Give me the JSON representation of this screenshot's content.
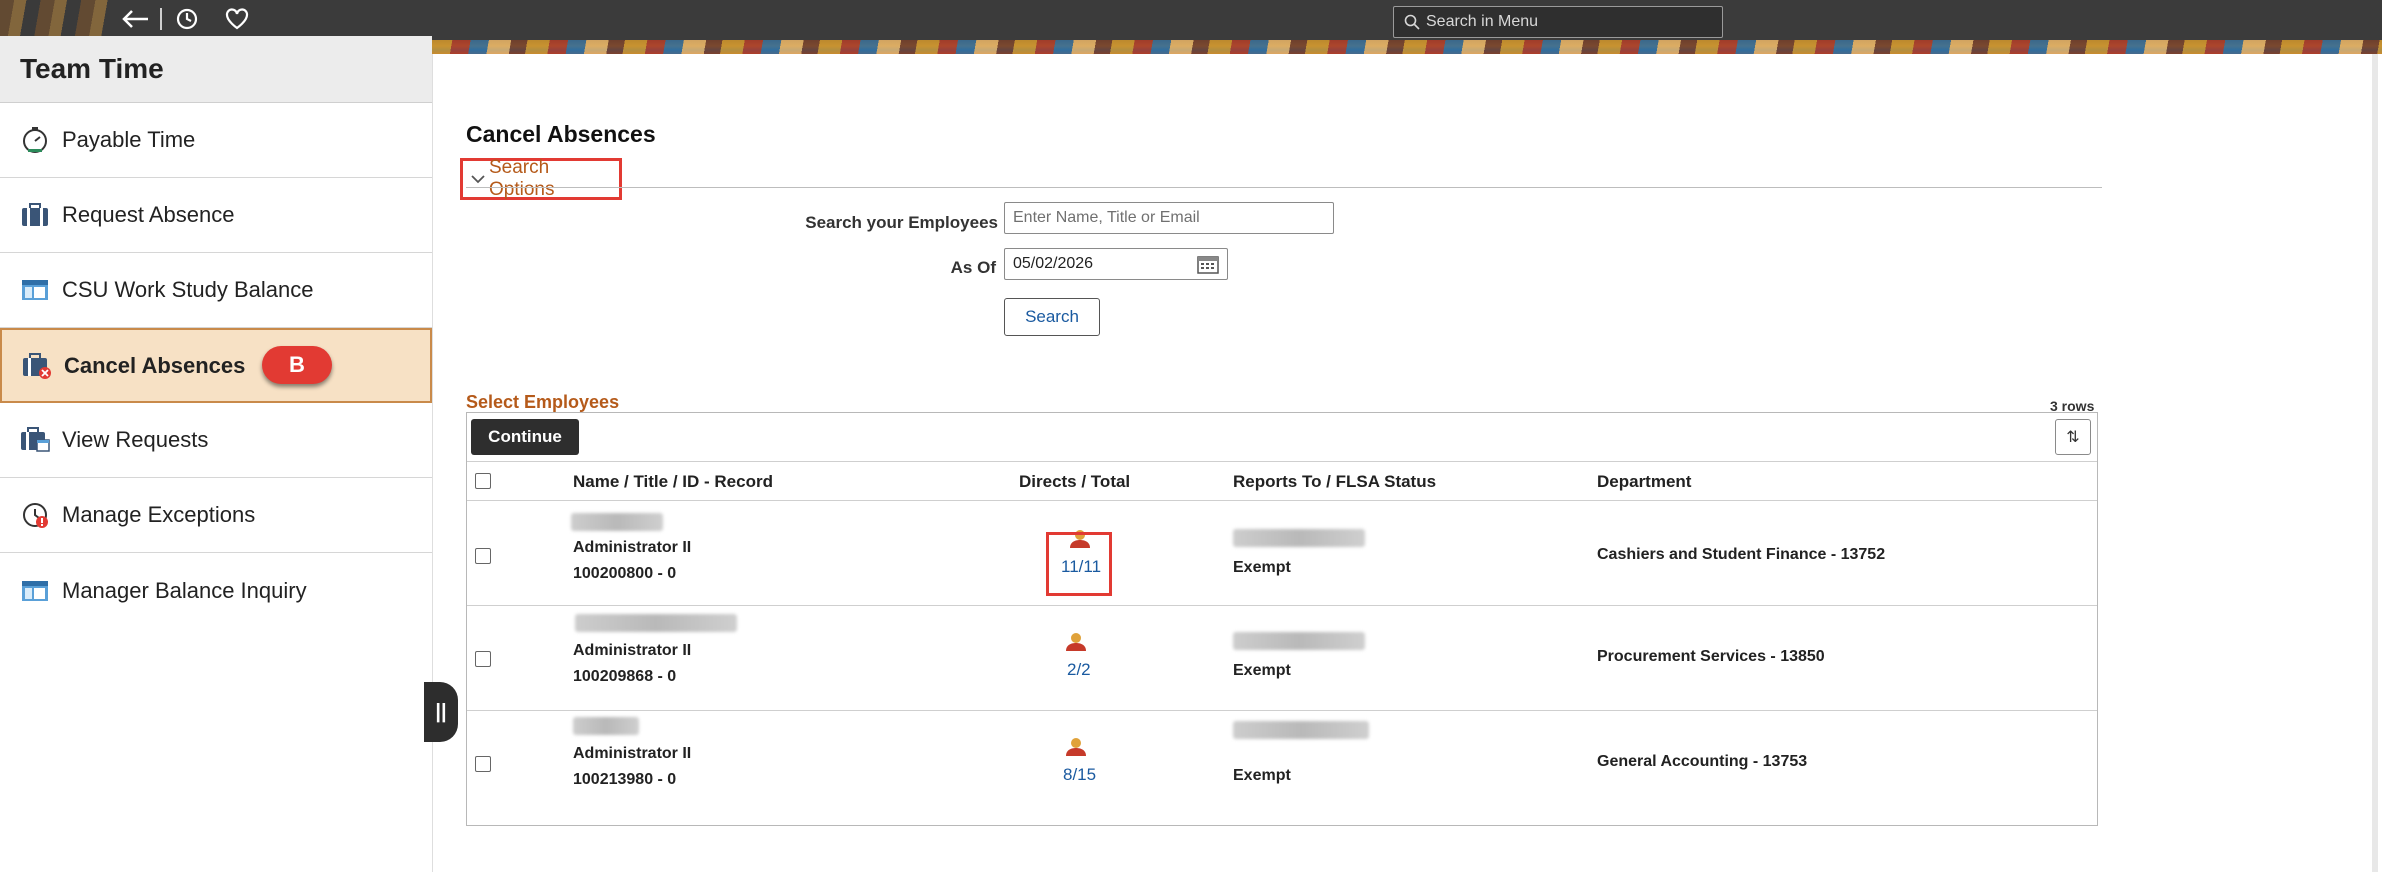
{
  "header": {
    "search_placeholder": "Search in Menu",
    "icons": [
      "back-arrow-icon",
      "history-icon",
      "favorites-icon",
      "search-icon"
    ]
  },
  "sidebar": {
    "title": "Team Time",
    "items": [
      {
        "label": "Payable Time",
        "icon": "stopwatch-icon"
      },
      {
        "label": "Request Absence",
        "icon": "briefcase-icon"
      },
      {
        "label": "CSU Work Study Balance",
        "icon": "table-icon"
      },
      {
        "label": "Cancel Absences",
        "icon": "briefcase-cancel-icon",
        "active": true,
        "badge": "B"
      },
      {
        "label": "View Requests",
        "icon": "briefcase-calendar-icon"
      },
      {
        "label": "Manage Exceptions",
        "icon": "exception-clock-icon"
      },
      {
        "label": "Manager Balance Inquiry",
        "icon": "table-icon"
      }
    ]
  },
  "main": {
    "title": "Cancel Absences",
    "search_options_label": "Search Options",
    "search_employees_label": "Search your Employees",
    "search_employees_placeholder": "Enter Name, Title or Email",
    "as_of_label": "As Of",
    "as_of_value": "05/02/2026",
    "search_button": "Search",
    "select_employees_title": "Select Employees",
    "rows_count": "3 rows",
    "continue_button": "Continue",
    "columns": [
      "Name / Title / ID - Record",
      "Directs / Total",
      "Reports To / FLSA Status",
      "Department"
    ],
    "rows": [
      {
        "title": "Administrator II",
        "id": "100200800 - 0",
        "directs": "11/11",
        "flsa": "Exempt",
        "department": "Cashiers and Student Finance - 13752"
      },
      {
        "title": "Administrator II",
        "id": "100209868 - 0",
        "directs": "2/2",
        "flsa": "Exempt",
        "department": "Procurement Services - 13850"
      },
      {
        "title": "Administrator II",
        "id": "100213980 - 0",
        "directs": "8/15",
        "flsa": "Exempt",
        "department": "General Accounting - 13753"
      }
    ]
  },
  "colors": {
    "accent_red": "#e23a33",
    "link_blue": "#1a5aa0",
    "section_brown": "#b55a1a",
    "active_bg": "#f7e1c5"
  }
}
